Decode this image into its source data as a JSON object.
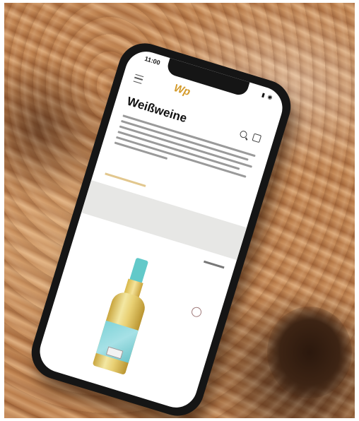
{
  "phone": {
    "status_time": "11:00",
    "status_icons": "▮ ◉",
    "logo_text": "Wp",
    "page_title": "Weißweine"
  },
  "icons": {
    "menu": "hamburger-icon",
    "search": "search-icon",
    "cart": "bag-icon",
    "wishlist": "heart-icon"
  },
  "colors": {
    "accent": "#d49a2a",
    "bottle_label": "#7fd3d8",
    "bottle_cap": "#62c9c9"
  }
}
